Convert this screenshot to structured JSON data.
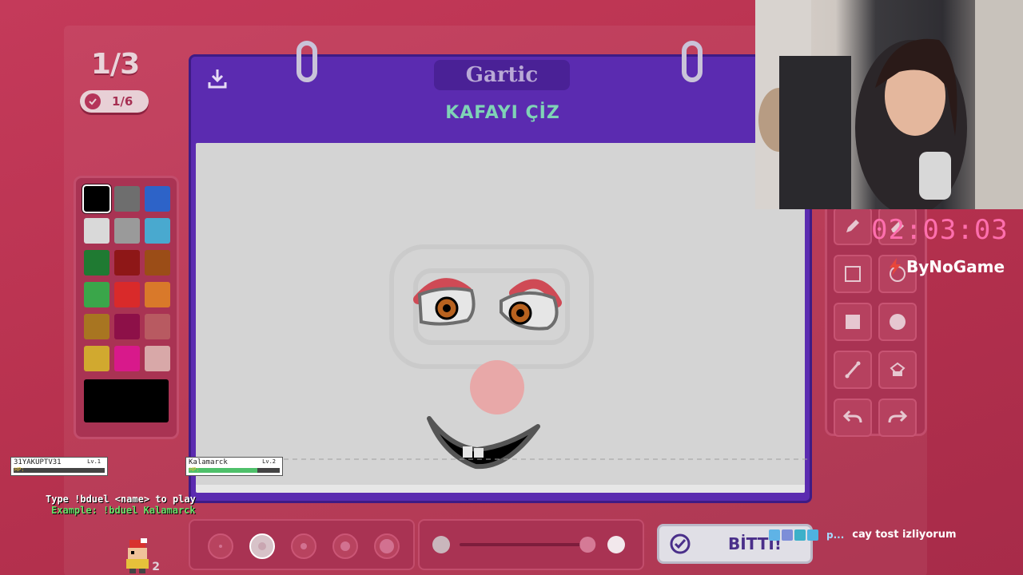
{
  "round": {
    "current": "1/3",
    "guesses": "1/6"
  },
  "board": {
    "brand": "Gartic",
    "task": "KAFAYI ÇİZ"
  },
  "palette": {
    "colors": [
      "#000000",
      "#6e6e6e",
      "#2d63c8",
      "#d9d9d9",
      "#9a9a9a",
      "#49a9cf",
      "#1f7a32",
      "#8e1717",
      "#9b4d17",
      "#3aa64a",
      "#d92a2a",
      "#d9792a",
      "#a87521",
      "#8d1048",
      "#b85a61",
      "#d1a92f",
      "#d8198b",
      "#d8a8a8"
    ],
    "selected": "#000000",
    "current_color": "#000000"
  },
  "tools": [
    "pencil-icon",
    "eraser-icon",
    "rectangle-outline-icon",
    "ellipse-outline-icon",
    "rectangle-filled-icon",
    "ellipse-filled-icon",
    "line-icon",
    "fill-bucket-icon",
    "undo-icon",
    "redo-icon"
  ],
  "stream": {
    "timer": "02:03:03",
    "sponsor": "ByNoGame"
  },
  "brush_sizes": {
    "count": 5,
    "selected_index": 1
  },
  "opacity": {
    "value": 0.85
  },
  "done_button": {
    "label": "BİTTİ!"
  },
  "duel": {
    "player1": {
      "name": "31YAKUPTV31",
      "level": "Lv.1",
      "hp": 0.0
    },
    "player2": {
      "name": "Kalamarck",
      "level": "Lv.2",
      "hp": 0.75
    },
    "hp_label": "HP:",
    "instruction": "Type !bduel <name> to play",
    "example": "Example: !bduel Kalamarck",
    "sprite_count": "2"
  },
  "chat": {
    "user": "p...",
    "message": "cay tost izliyorum"
  }
}
